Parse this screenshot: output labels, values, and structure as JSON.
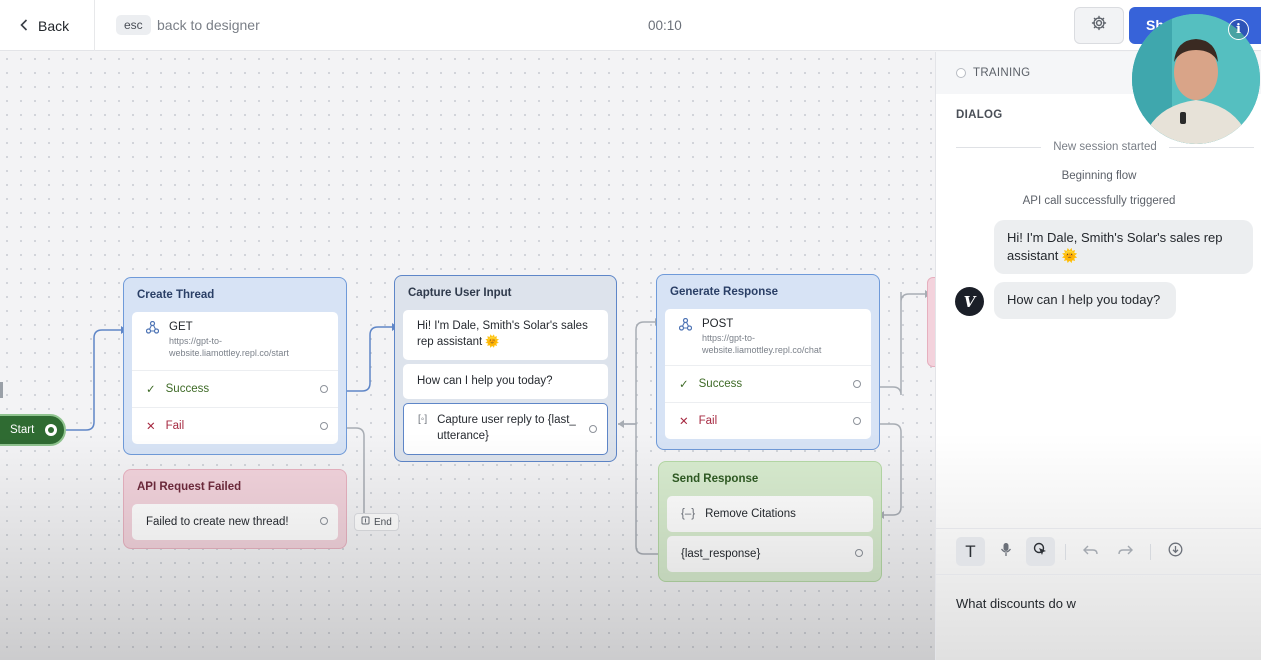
{
  "header": {
    "back_label": "Back",
    "esc_badge": "esc",
    "back_to_designer": "back to designer",
    "timer": "00:10",
    "share_label": "Sh"
  },
  "canvas": {
    "start_label": "Start",
    "end_label": "End",
    "create_thread": {
      "title": "Create Thread",
      "method": "GET",
      "url": "https://gpt-to-website.liamottley.repl.co/start",
      "success": "Success",
      "fail": "Fail"
    },
    "api_failed": {
      "title": "API Request Failed",
      "message": "Failed to create new thread!"
    },
    "capture_input": {
      "title": "Capture User Input",
      "message1": "Hi! I'm Dale, Smith's Solar's sales rep assistant 🌞",
      "message2": "How can I help you today?",
      "capture": "Capture user reply to {last_utterance}"
    },
    "generate_response": {
      "title": "Generate Response",
      "method": "POST",
      "url": "https://gpt-to-website.liamottley.repl.co/chat",
      "success": "Success",
      "fail": "Fail"
    },
    "send_response": {
      "title": "Send Response",
      "step1": "Remove Citations",
      "step2": "{last_response}"
    }
  },
  "panel": {
    "training_label": "TRAINING",
    "dialog_label": "DIALOG",
    "session_started": "New session started",
    "beginning_flow": "Beginning flow",
    "api_triggered": "API call successfully triggered",
    "user_message": "Hi! I'm Dale, Smith's Solar's sales rep assistant 🌞",
    "bot_message": "How can I help you today?",
    "bot_avatar": "V",
    "input_value": "What discounts do w"
  },
  "icons": {
    "info": "i",
    "text_tool": "T"
  },
  "colors": {
    "accent": "#3763d9",
    "success": "#3f6b27",
    "fail": "#a62941",
    "start_node": "#2f6b32"
  }
}
